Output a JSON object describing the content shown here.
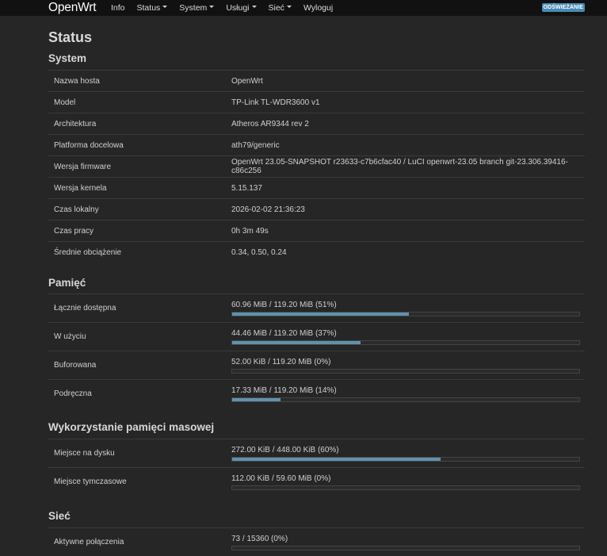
{
  "navbar": {
    "brand": "OpenWrt",
    "items": [
      {
        "label": "Info",
        "dropdown": false
      },
      {
        "label": "Status",
        "dropdown": true
      },
      {
        "label": "System",
        "dropdown": true
      },
      {
        "label": "Usługi",
        "dropdown": true
      },
      {
        "label": "Sieć",
        "dropdown": true
      },
      {
        "label": "Wyloguj",
        "dropdown": false
      }
    ],
    "refresh_label": "ODŚWIEŻANIE"
  },
  "page": {
    "title": "Status"
  },
  "system": {
    "title": "System",
    "rows": [
      {
        "label": "Nazwa hosta",
        "value": "OpenWrt"
      },
      {
        "label": "Model",
        "value": "TP-Link TL-WDR3600 v1"
      },
      {
        "label": "Architektura",
        "value": "Atheros AR9344 rev 2"
      },
      {
        "label": "Platforma docelowa",
        "value": "ath79/generic"
      },
      {
        "label": "Wersja firmware",
        "value": "OpenWrt 23.05-SNAPSHOT r23633-c7b6cfac40 / LuCI openwrt-23.05 branch git-23.306.39416-c86c256"
      },
      {
        "label": "Wersja kernela",
        "value": "5.15.137"
      },
      {
        "label": "Czas lokalny",
        "value": "2026-02-02 21:36:23"
      },
      {
        "label": "Czas pracy",
        "value": "0h 3m 49s"
      },
      {
        "label": "Średnie obciążenie",
        "value": "0.34, 0.50, 0.24"
      }
    ]
  },
  "memory": {
    "title": "Pamięć",
    "rows": [
      {
        "label": "Łącznie dostępna",
        "value": "60.96 MiB / 119.20 MiB (51%)",
        "fraction": 0.51
      },
      {
        "label": "W użyciu",
        "value": "44.46 MiB / 119.20 MiB (37%)",
        "fraction": 0.37
      },
      {
        "label": "Buforowana",
        "value": "52.00 KiB / 119.20 MiB (0%)",
        "fraction": 0.0
      },
      {
        "label": "Podręczna",
        "value": "17.33 MiB / 119.20 MiB (14%)",
        "fraction": 0.14
      }
    ]
  },
  "storage": {
    "title": "Wykorzystanie pamięci masowej",
    "rows": [
      {
        "label": "Miejsce na dysku",
        "value": "272.00 KiB / 448.00 KiB (60%)",
        "fraction": 0.6
      },
      {
        "label": "Miejsce tymczasowe",
        "value": "112.00 KiB / 59.60 MiB (0%)",
        "fraction": 0.0
      }
    ]
  },
  "network": {
    "title": "Sieć",
    "rows": [
      {
        "label": "Aktywne połączenia",
        "value": "73 / 15360 (0%)",
        "fraction": 0.0
      }
    ]
  },
  "colors": {
    "accent": "#5f92ad",
    "navbar": "#111111",
    "background": "#262626",
    "refresh_badge": "#4a8ab5"
  }
}
